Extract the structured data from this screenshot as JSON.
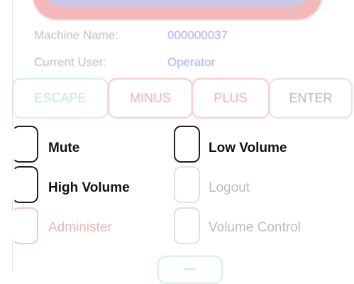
{
  "info": {
    "machine_name_label": "Machine Name:",
    "machine_name_value": "000000037",
    "current_user_label": "Current User:",
    "current_user_value": "Operator"
  },
  "keys": {
    "escape": "ESCAPE",
    "minus": "MINUS",
    "plus": "PLUS",
    "enter": "ENTER"
  },
  "options": {
    "mute": "Mute",
    "low_volume": "Low Volume",
    "high_volume": "High Volume",
    "logout": "Logout",
    "administer": "Administer",
    "volume_control": "Volume Control"
  },
  "colors": {
    "accent_green": "#bfe9ca",
    "accent_red": "#f3aab0",
    "value_blue": "#a7a9f0"
  }
}
